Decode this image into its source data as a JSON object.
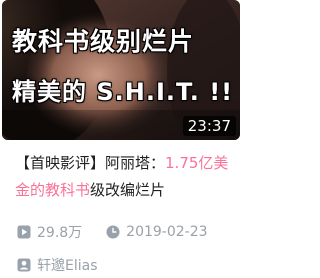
{
  "video": {
    "thumbnail": {
      "overlay_line1": "教科书级别烂片",
      "overlay_line2": "精美的 S.H.I.T. !!",
      "duration": "23:37"
    },
    "title_parts": {
      "prefix": "【首映影评】阿丽塔：",
      "highlight": "1.75亿美金的教科书",
      "suffix": "级改编烂片"
    },
    "views": "29.8万",
    "date": "2019-02-23",
    "author": "轩邈Elias",
    "icons": {
      "views": "play-icon",
      "date": "clock-icon",
      "author": "user-icon"
    }
  },
  "colors": {
    "highlight": "#fb7299",
    "meta": "#99a2aa",
    "title": "#212121"
  }
}
